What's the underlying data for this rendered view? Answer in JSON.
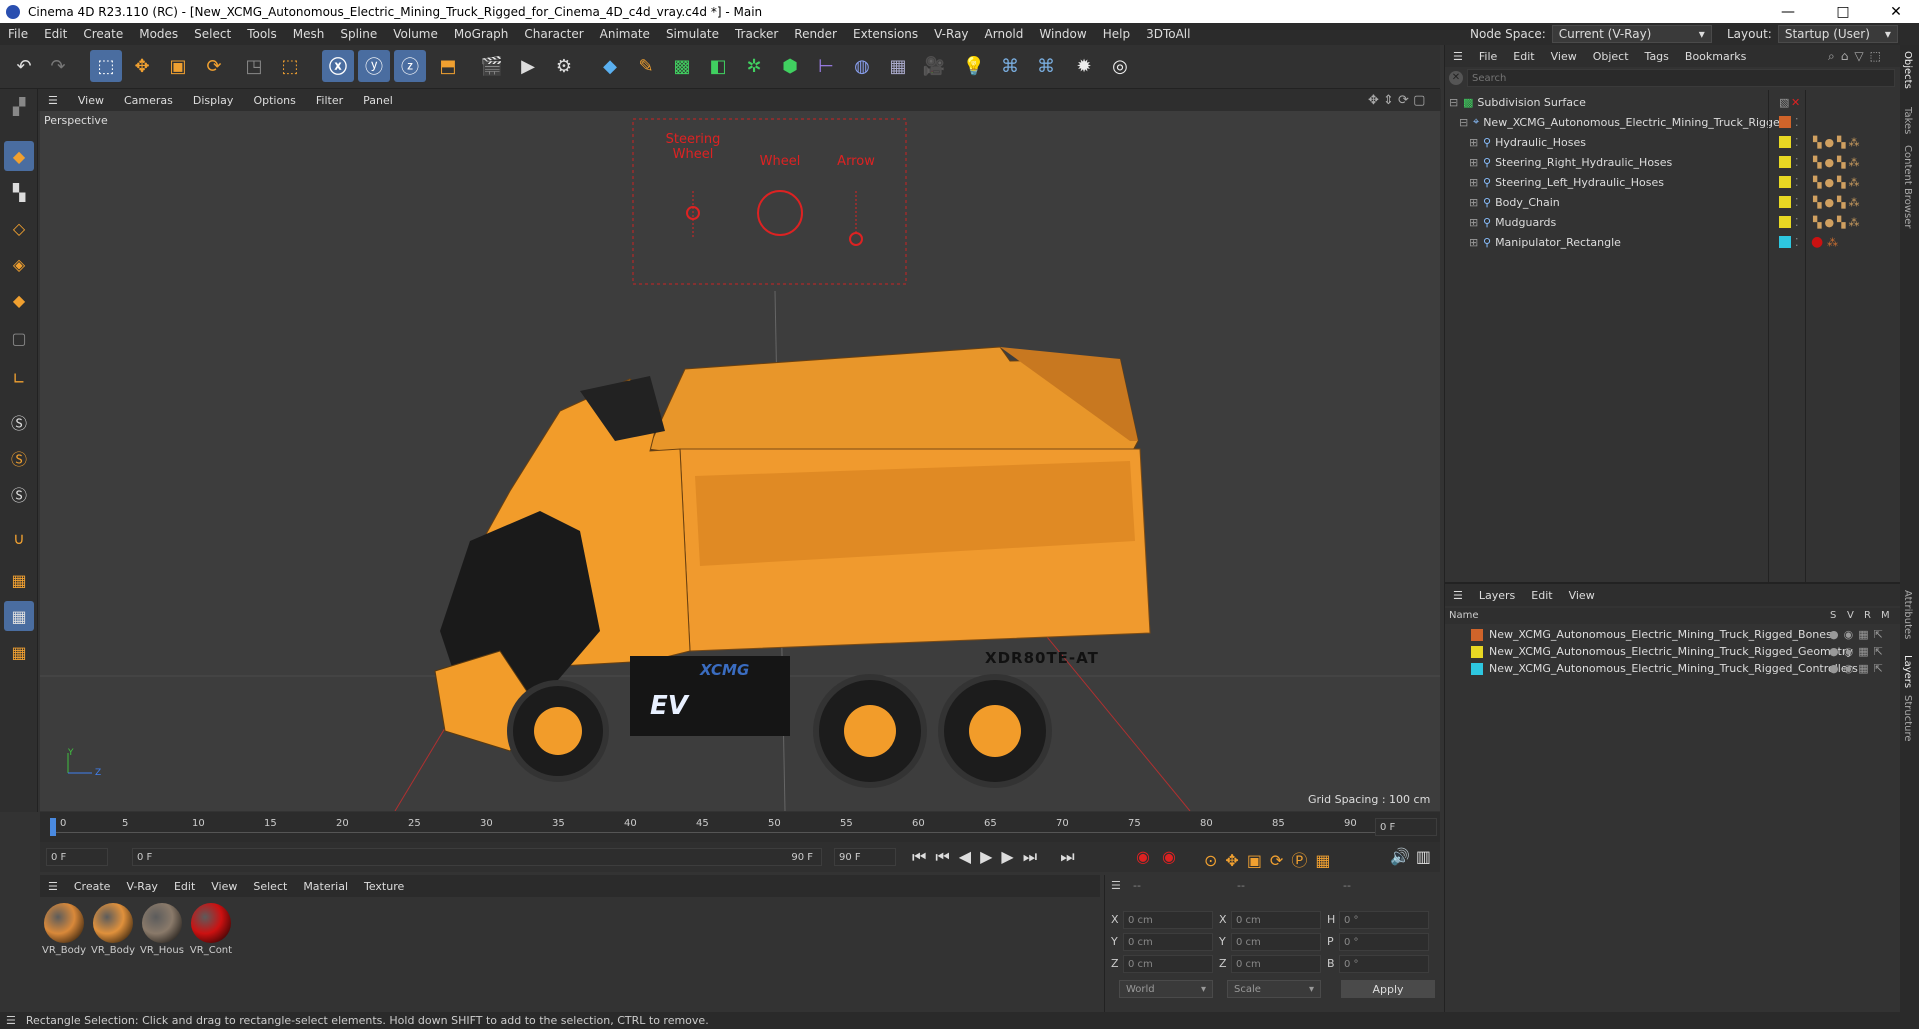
{
  "window": {
    "title": "Cinema 4D R23.110 (RC) - [New_XCMG_Autonomous_Electric_Mining_Truck_Rigged_for_Cinema_4D_c4d_vray.c4d *] - Main",
    "minimize": "—",
    "maximize": "□",
    "close": "✕"
  },
  "menu": {
    "items": [
      "File",
      "Edit",
      "Create",
      "Modes",
      "Select",
      "Tools",
      "Mesh",
      "Spline",
      "Volume",
      "MoGraph",
      "Character",
      "Animate",
      "Simulate",
      "Tracker",
      "Render",
      "Extensions",
      "V-Ray",
      "Arnold",
      "Window",
      "Help",
      "3DToAll"
    ],
    "node_space_label": "Node Space:",
    "node_space_value": "Current (V-Ray)",
    "layout_label": "Layout:",
    "layout_value": "Startup (User)"
  },
  "viewport": {
    "menu": [
      "View",
      "Cameras",
      "Display",
      "Options",
      "Filter",
      "Panel"
    ],
    "label": "Perspective",
    "grid_spacing": "Grid Spacing : 100 cm",
    "controller_labels": [
      "Steering Wheel",
      "Wheel",
      "Arrow"
    ],
    "truck_model": "XDR80TE-AT",
    "brand": "XCMG",
    "ev_badge": "EV"
  },
  "timeline": {
    "ticks": [
      "0",
      "5",
      "10",
      "15",
      "20",
      "25",
      "30",
      "35",
      "40",
      "45",
      "50",
      "55",
      "60",
      "65",
      "70",
      "75",
      "80",
      "85",
      "90"
    ],
    "frame_field": "0 F"
  },
  "playbar": {
    "start": "0 F",
    "current": "0 F",
    "end_slider": "90 F",
    "end": "90 F"
  },
  "material": {
    "menu": [
      "Create",
      "V-Ray",
      "Edit",
      "View",
      "Select",
      "Material",
      "Texture"
    ],
    "items": [
      {
        "name": "VR_Body",
        "color": "#d9893a"
      },
      {
        "name": "VR_Body",
        "color": "#e0913c"
      },
      {
        "name": "VR_Hous",
        "color": "#8a7a6a"
      },
      {
        "name": "VR_Cont",
        "color": "#cc1111"
      }
    ]
  },
  "coords": {
    "headers": [
      "--",
      "--",
      "--"
    ],
    "rows": [
      {
        "a": "X",
        "av": "0 cm",
        "b": "X",
        "bv": "0 cm",
        "c": "H",
        "cv": "0 °"
      },
      {
        "a": "Y",
        "av": "0 cm",
        "b": "Y",
        "bv": "0 cm",
        "c": "P",
        "cv": "0 °"
      },
      {
        "a": "Z",
        "av": "0 cm",
        "b": "Z",
        "bv": "0 cm",
        "c": "B",
        "cv": "0 °"
      }
    ],
    "world": "World",
    "scale": "Scale",
    "apply": "Apply"
  },
  "objects": {
    "menu": [
      "File",
      "Edit",
      "View",
      "Object",
      "Tags",
      "Bookmarks"
    ],
    "search_placeholder": "Search",
    "items": [
      {
        "name": "Subdivision Surface",
        "color": "#999999"
      },
      {
        "name": "New_XCMG_Autonomous_Electric_Mining_Truck_Rigged",
        "color": "#d0642a"
      },
      {
        "name": "Hydraulic_Hoses",
        "color": "#e8d823"
      },
      {
        "name": "Steering_Right_Hydraulic_Hoses",
        "color": "#e8d823"
      },
      {
        "name": "Steering_Left_Hydraulic_Hoses",
        "color": "#e8d823"
      },
      {
        "name": "Body_Chain",
        "color": "#e8d823"
      },
      {
        "name": "Mudguards",
        "color": "#e8d823"
      },
      {
        "name": "Manipulator_Rectangle",
        "color": "#2ec7e0"
      }
    ]
  },
  "layers": {
    "menu": [
      "Layers",
      "Edit",
      "View"
    ],
    "col_name": "Name",
    "cols": [
      "S",
      "V",
      "R",
      "M"
    ],
    "items": [
      {
        "name": "New_XCMG_Autonomous_Electric_Mining_Truck_Rigged_Bones",
        "color": "#d0642a"
      },
      {
        "name": "New_XCMG_Autonomous_Electric_Mining_Truck_Rigged_Geometry",
        "color": "#e8d823"
      },
      {
        "name": "New_XCMG_Autonomous_Electric_Mining_Truck_Rigged_Controllers",
        "color": "#2ec7e0"
      }
    ]
  },
  "side_tabs": [
    "Objects",
    "Takes",
    "Content Browser",
    "Attributes",
    "Layers",
    "Structure"
  ],
  "status": "Rectangle Selection: Click and drag to rectangle-select elements. Hold down SHIFT to add to the selection, CTRL to remove."
}
